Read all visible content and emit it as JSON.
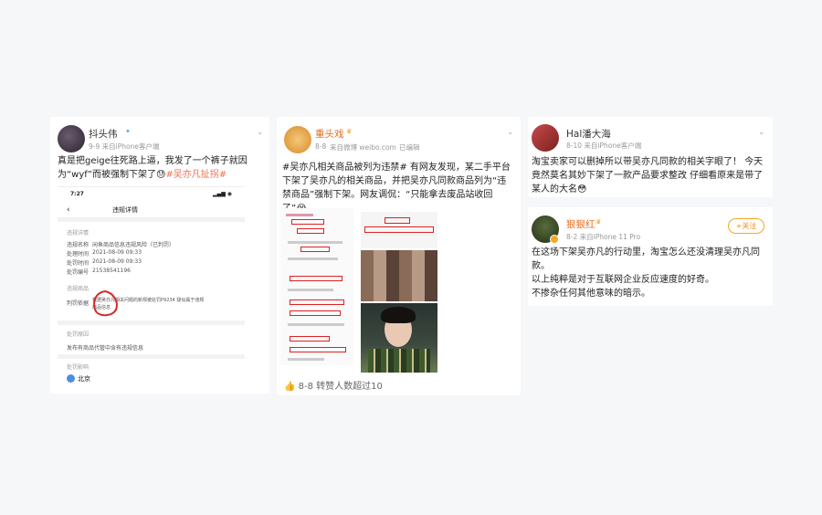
{
  "card1": {
    "name": "抖头伟",
    "meta": "9-9  来自iPhone客户端",
    "text_line1": "真是把geige往死路上逼，我发了一个裤子就因",
    "text_line2_a": "为“wyf”而被强制下架了",
    "text_line2_emoji": "😓",
    "text_line2_tag": "#吴亦凡扯拐#",
    "screenshot": {
      "time": "7:27",
      "title": "违规详情",
      "section1": "违规详情",
      "rows": [
        {
          "label": "违规名称",
          "value": "闲鱼商品信息违规风险（已判罚）"
        },
        {
          "label": "处理时间",
          "value": "2021-08-09 09:33"
        },
        {
          "label": "处罚时间",
          "value": "2021-08-09 09:33"
        },
        {
          "label": "处罚编号",
          "value": "2153854119​6"
        }
      ],
      "goods_label": "违规商品",
      "reason_label": "判罚依据",
      "reason_text_1": "根据吴亦凡相关问题的新规被处罚P9234 疑似属于违规",
      "reason_text_2": "商品信息",
      "section2": "处罚原因",
      "section2_text": "发布有商品代管中含有违规信息",
      "section3": "处罚影响",
      "location": "北京"
    }
  },
  "card2": {
    "name": "重头戏",
    "meta_date": "8-8",
    "meta_source": "来自微博 weibo.com",
    "meta_edited": "已编辑",
    "text": "#吴亦凡相关商品被列为违禁# 有网友发现，某二手平台下架了吴亦凡的相关商品，并把吴亦凡同款商品列为“违禁商品”强制下架。网友调侃：“只能拿去废品站收回了”",
    "emoji": "😭",
    "footer": "8-8 转赞人数超过10"
  },
  "card3": {
    "name": "Hal潘大海",
    "meta": "8-10  来自iPhone客户端",
    "text": "淘宝卖家可以删掉所以带吴亦凡同款的相关字眼了！ 今天竟然莫名其妙下架了一款产品要求整改 仔细看原来是带了某人的大名",
    "emoji": "😳"
  },
  "card4": {
    "name": "狠狠红",
    "meta": "8-2  来自iPhone 11 Pro",
    "follow_label": "+关注",
    "line1": "在这场下架吴亦凡的行动里，淘宝怎么还没清理吴亦凡同款。",
    "line2": "以上纯粹是对于互联网企业反应速度的好奇。",
    "line3": "不掺杂任何其他意味的暗示。"
  }
}
